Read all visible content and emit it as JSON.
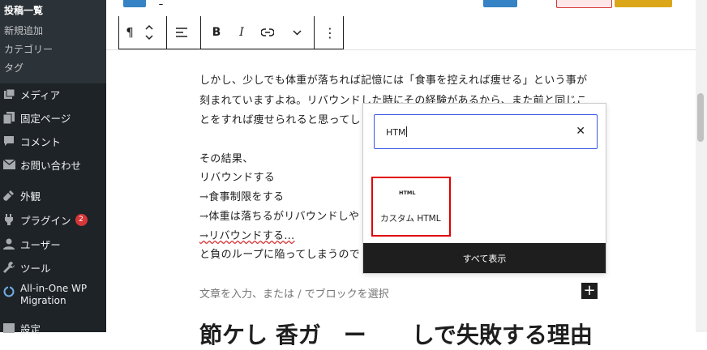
{
  "sidebar": {
    "submenu": [
      {
        "label": "投稿一覧",
        "current": true
      },
      {
        "label": "新規追加"
      },
      {
        "label": "カテゴリー"
      },
      {
        "label": "タグ"
      }
    ],
    "items": [
      {
        "label": "メディア",
        "icon": "media-icon"
      },
      {
        "label": "固定ページ",
        "icon": "page-icon"
      },
      {
        "label": "コメント",
        "icon": "comment-icon"
      },
      {
        "label": "お問い合わせ",
        "icon": "mail-icon"
      },
      {
        "label": "外観",
        "icon": "appearance-icon"
      },
      {
        "label": "プラグイン",
        "icon": "plugin-icon",
        "badge": "2"
      },
      {
        "label": "ユーザー",
        "icon": "user-icon"
      },
      {
        "label": "ツール",
        "icon": "wrench-icon"
      },
      {
        "label": "All-in-One WP Migration",
        "line1": "All-in-One WP",
        "line2": "Migration",
        "icon": "migration-icon"
      },
      {
        "label": "設定",
        "icon": "settings-icon"
      }
    ],
    "colors": {
      "background": "#1d2327",
      "submenu": "#2c3338",
      "badge": "#d63638"
    }
  },
  "toolbar": {
    "paragraph": "¶",
    "bold": "B",
    "italic": "I",
    "more": "⋮"
  },
  "editor": {
    "paragraphs": [
      "しかし、少しでも体重が落ちれば記憶には「食事を控えれば痩せる」という事が",
      "刻まれていますよね。リバウンドした時にその経験があるから、また前と同じこ",
      "とをすれば痩せられると思ってし",
      "その結果、",
      "リバウンドする",
      "→食事制限をする",
      "→体重は落ちるがリバウンドしや",
      "→リバウンドする…",
      "と負のループに陥ってしまうので"
    ],
    "placeholder": "文章を入力、または / でブロックを選択",
    "heading_partial": "節ケし 香ガ　ー　　しで失敗する理由"
  },
  "inserter": {
    "search_value": "HTM",
    "result": {
      "icon_text": "HTML",
      "label": "カスタム HTML"
    },
    "browse_all": "すべて表示",
    "colors": {
      "focus": "#3858e9",
      "highlight": "#e00000"
    }
  }
}
